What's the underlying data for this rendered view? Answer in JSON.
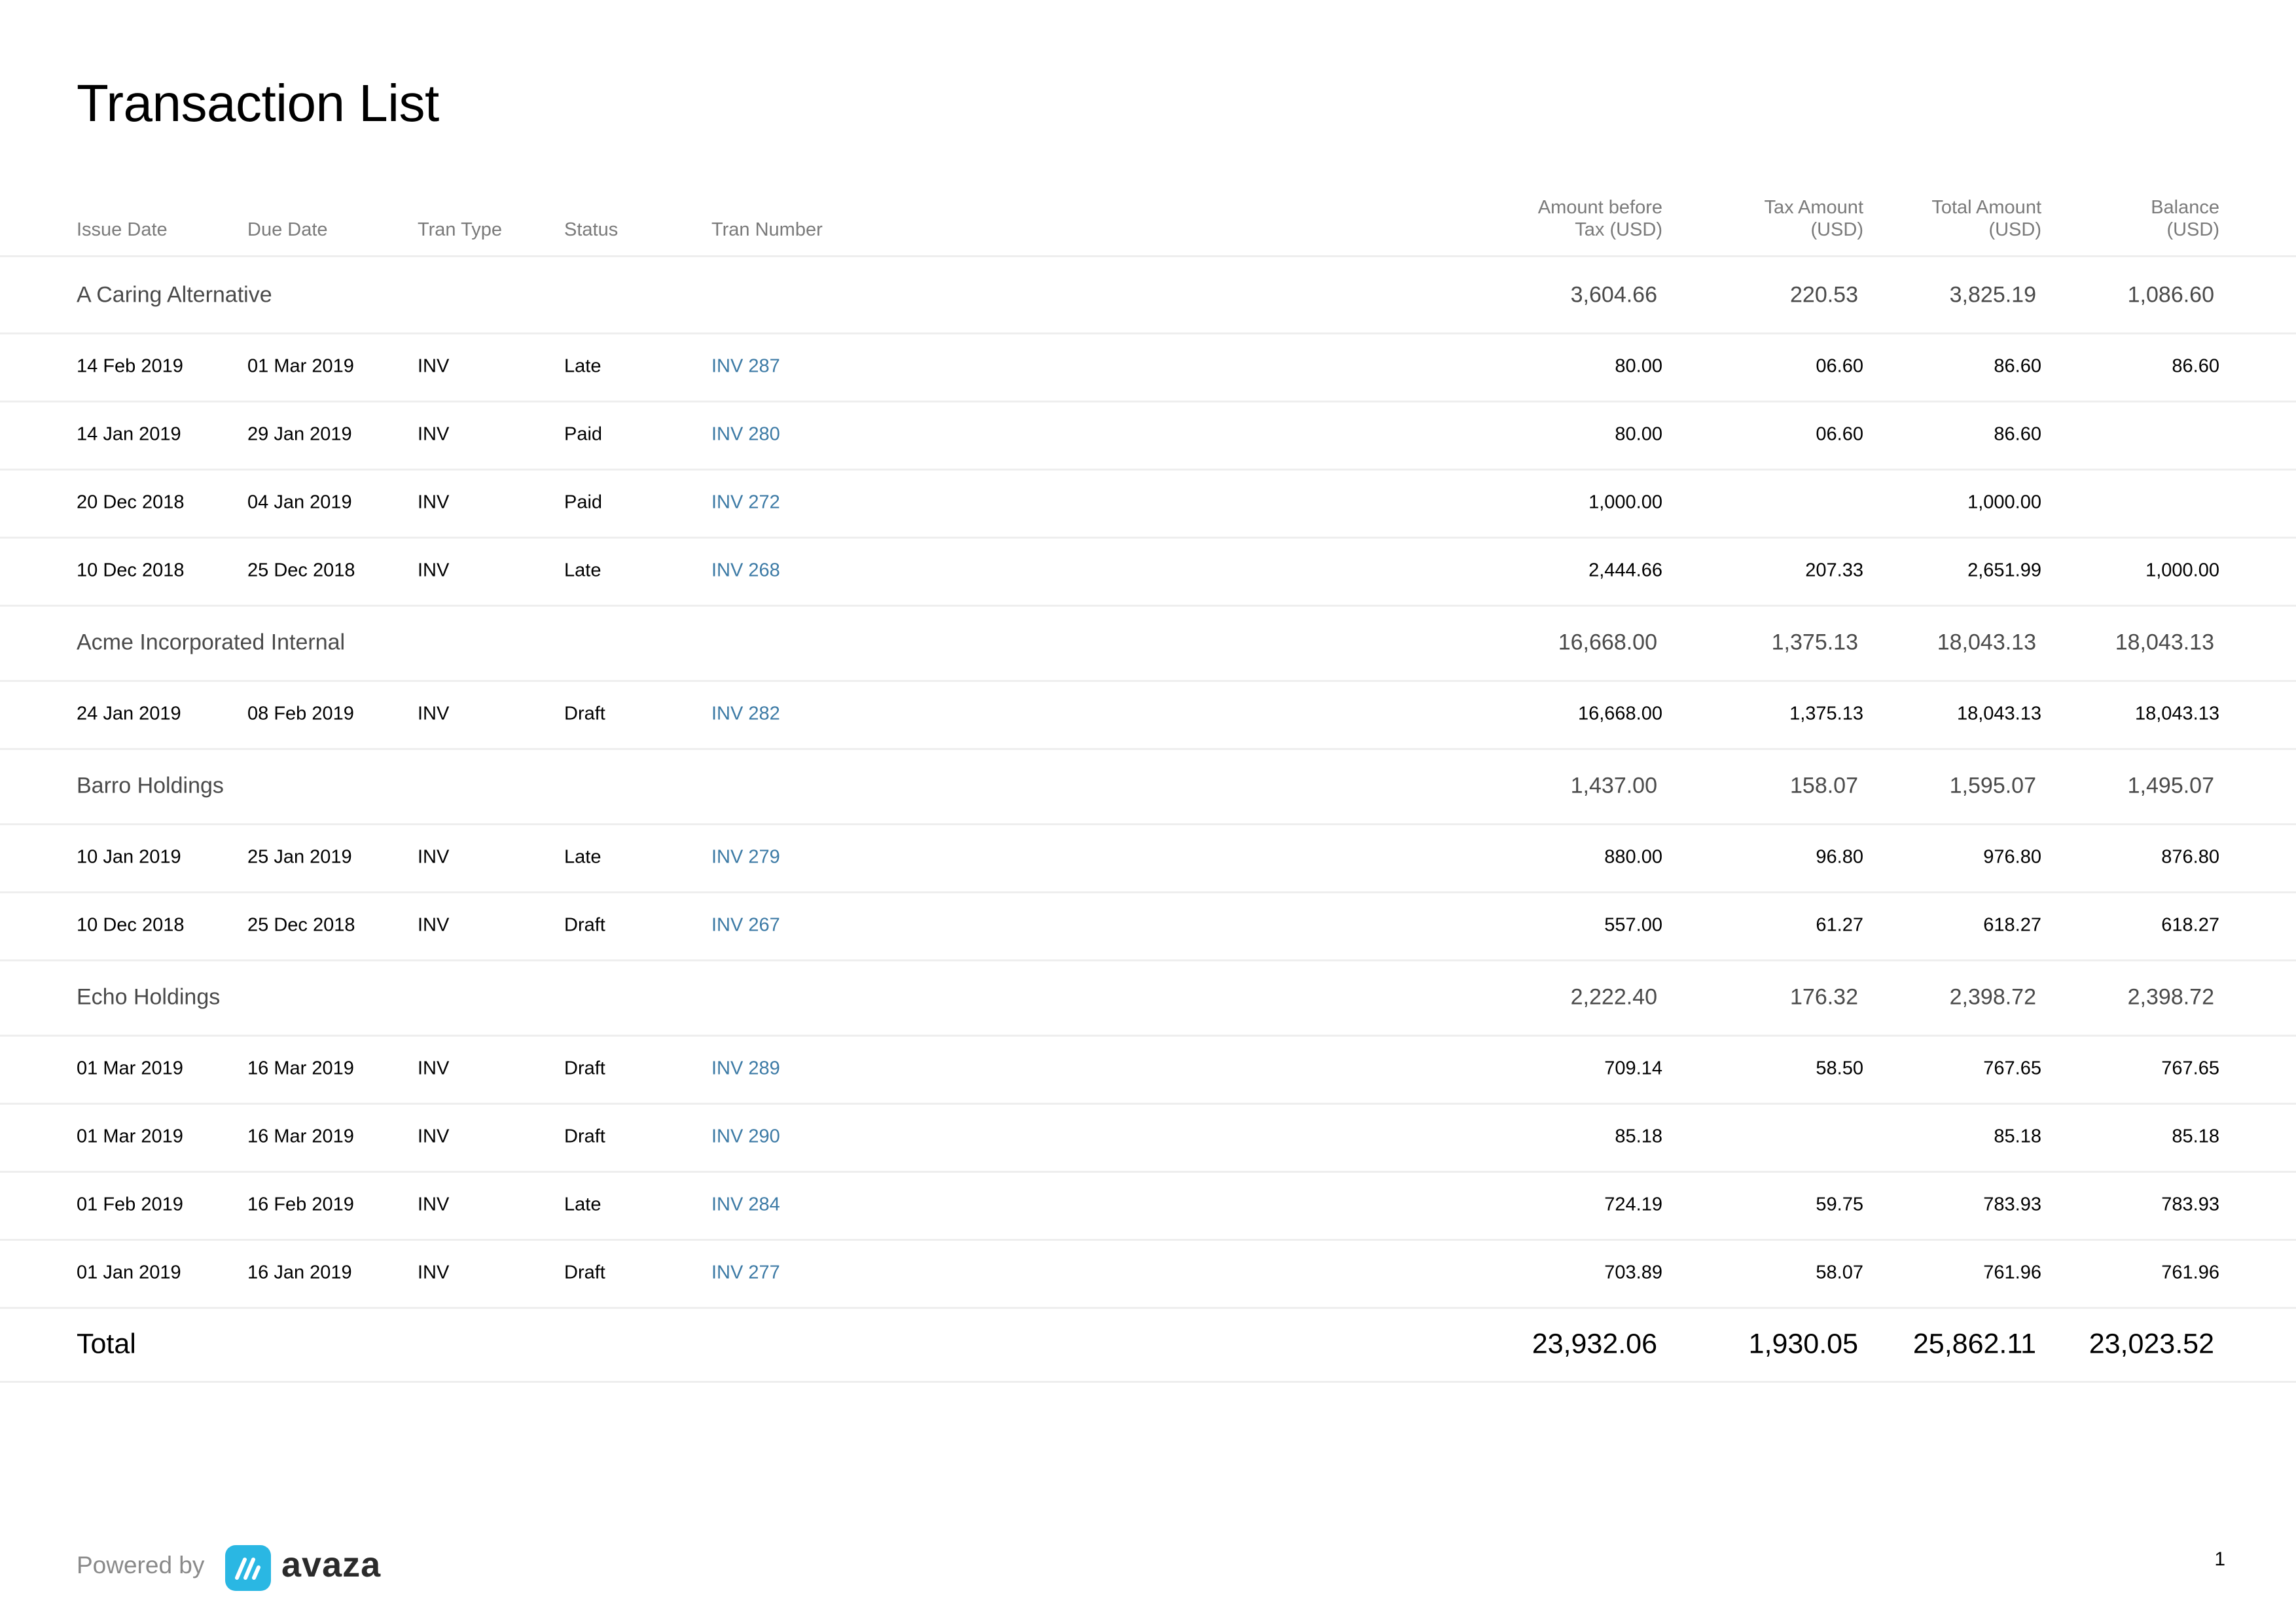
{
  "title": "Transaction List",
  "columns": {
    "issue_date": "Issue Date",
    "due_date": "Due Date",
    "tran_type": "Tran Type",
    "status": "Status",
    "tran_number": "Tran Number",
    "amount_before_tax": "Amount before\nTax (USD)",
    "tax_amount": "Tax Amount\n(USD)",
    "total_amount": "Total Amount\n(USD)",
    "balance": "Balance\n(USD)"
  },
  "rows": [
    {
      "kind": "group",
      "name": "A Caring Alternative",
      "amount": "3,604.66",
      "tax": "220.53",
      "total": "3,825.19",
      "balance": "1,086.60"
    },
    {
      "kind": "detail",
      "issue": "14 Feb 2019",
      "due": "01 Mar 2019",
      "type": "INV",
      "status": "Late",
      "number": "INV 287",
      "amount": "80.00",
      "tax": "06.60",
      "total": "86.60",
      "balance": "86.60"
    },
    {
      "kind": "detail",
      "issue": "14 Jan 2019",
      "due": "29 Jan 2019",
      "type": "INV",
      "status": "Paid",
      "number": "INV 280",
      "amount": "80.00",
      "tax": "06.60",
      "total": "86.60",
      "balance": ""
    },
    {
      "kind": "detail",
      "issue": "20 Dec 2018",
      "due": "04 Jan 2019",
      "type": "INV",
      "status": "Paid",
      "number": "INV 272",
      "amount": "1,000.00",
      "tax": "",
      "total": "1,000.00",
      "balance": ""
    },
    {
      "kind": "detail",
      "issue": "10 Dec 2018",
      "due": "25 Dec 2018",
      "type": "INV",
      "status": "Late",
      "number": "INV 268",
      "amount": "2,444.66",
      "tax": "207.33",
      "total": "2,651.99",
      "balance": "1,000.00"
    },
    {
      "kind": "group",
      "name": "Acme Incorporated Internal",
      "amount": "16,668.00",
      "tax": "1,375.13",
      "total": "18,043.13",
      "balance": "18,043.13"
    },
    {
      "kind": "detail",
      "issue": "24 Jan 2019",
      "due": "08 Feb 2019",
      "type": "INV",
      "status": "Draft",
      "number": "INV 282",
      "amount": "16,668.00",
      "tax": "1,375.13",
      "total": "18,043.13",
      "balance": "18,043.13"
    },
    {
      "kind": "group",
      "name": "Barro Holdings",
      "amount": "1,437.00",
      "tax": "158.07",
      "total": "1,595.07",
      "balance": "1,495.07"
    },
    {
      "kind": "detail",
      "issue": "10 Jan 2019",
      "due": "25 Jan 2019",
      "type": "INV",
      "status": "Late",
      "number": "INV 279",
      "amount": "880.00",
      "tax": "96.80",
      "total": "976.80",
      "balance": "876.80"
    },
    {
      "kind": "detail",
      "issue": "10 Dec 2018",
      "due": "25 Dec 2018",
      "type": "INV",
      "status": "Draft",
      "number": "INV 267",
      "amount": "557.00",
      "tax": "61.27",
      "total": "618.27",
      "balance": "618.27"
    },
    {
      "kind": "group",
      "name": "Echo Holdings",
      "amount": "2,222.40",
      "tax": "176.32",
      "total": "2,398.72",
      "balance": "2,398.72"
    },
    {
      "kind": "detail",
      "issue": "01 Mar 2019",
      "due": "16 Mar 2019",
      "type": "INV",
      "status": "Draft",
      "number": "INV 289",
      "amount": "709.14",
      "tax": "58.50",
      "total": "767.65",
      "balance": "767.65"
    },
    {
      "kind": "detail",
      "issue": "01 Mar 2019",
      "due": "16 Mar 2019",
      "type": "INV",
      "status": "Draft",
      "number": "INV 290",
      "amount": "85.18",
      "tax": "",
      "total": "85.18",
      "balance": "85.18"
    },
    {
      "kind": "detail",
      "issue": "01 Feb 2019",
      "due": "16 Feb 2019",
      "type": "INV",
      "status": "Late",
      "number": "INV 284",
      "amount": "724.19",
      "tax": "59.75",
      "total": "783.93",
      "balance": "783.93"
    },
    {
      "kind": "detail",
      "issue": "01 Jan 2019",
      "due": "16 Jan 2019",
      "type": "INV",
      "status": "Draft",
      "number": "INV 277",
      "amount": "703.89",
      "tax": "58.07",
      "total": "761.96",
      "balance": "761.96"
    },
    {
      "kind": "total",
      "name": "Total",
      "amount": "23,932.06",
      "tax": "1,930.05",
      "total": "25,862.11",
      "balance": "23,023.52"
    }
  ],
  "footer": {
    "powered_by": "Powered by",
    "brand": "avaza",
    "page_number": "1"
  },
  "colors": {
    "link": "#3c7aa5",
    "brand_accent": "#2ab7e3"
  },
  "icons": {
    "brand_logo": "avaza-logo-icon"
  }
}
